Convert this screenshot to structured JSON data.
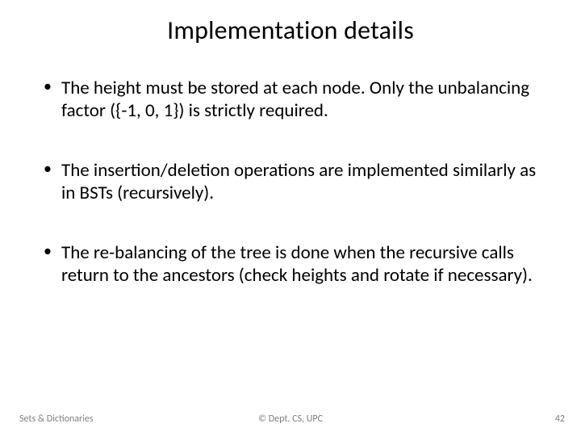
{
  "title": "Implementation details",
  "bullets": [
    "The height must be stored at each node. Only the unbalancing factor ({-1, 0, 1}) is strictly required.",
    "The insertion/deletion operations are implemented similarly as in BSTs (recursively).",
    "The re-balancing of the tree is done when the recursive calls return to the ancestors (check heights and rotate if necessary)."
  ],
  "footer": {
    "left": "Sets & Dictionaries",
    "center": "© Dept. CS, UPC",
    "right": "42"
  }
}
